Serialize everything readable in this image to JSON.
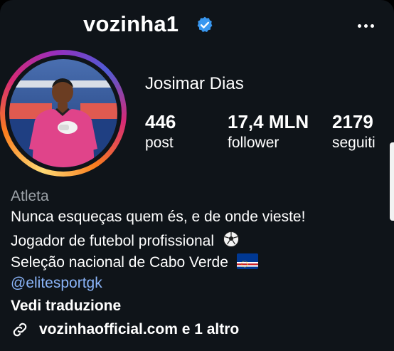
{
  "header": {
    "username": "vozinha1",
    "verified_icon": "verified-badge-icon",
    "more_icon": "more-options-icon"
  },
  "profile": {
    "display_name": "Josimar Dias",
    "stats": {
      "posts": {
        "value": "446",
        "label": "post"
      },
      "followers": {
        "value": "17,4 MLN",
        "label": "follower"
      },
      "following": {
        "value": "2179",
        "label": "seguiti"
      }
    },
    "category": "Atleta",
    "bio": [
      "Nunca esqueças quem és, e de onde vieste!",
      "Jogador de futebol profissional",
      "Seleção nacional de Cabo Verde"
    ],
    "bio_icons": [
      "soccer-ball-icon",
      "cape-verde-flag-icon"
    ],
    "mention": "@elitesportgk",
    "translate_label": "Vedi traduzione",
    "link": {
      "icon": "link-icon",
      "text": "vozinhaofficial.com e 1 altro"
    }
  },
  "colors": {
    "background": "#0f1419",
    "verified": "#3897f0",
    "mention": "#8ab4f8",
    "muted": "#9aa0a6"
  }
}
